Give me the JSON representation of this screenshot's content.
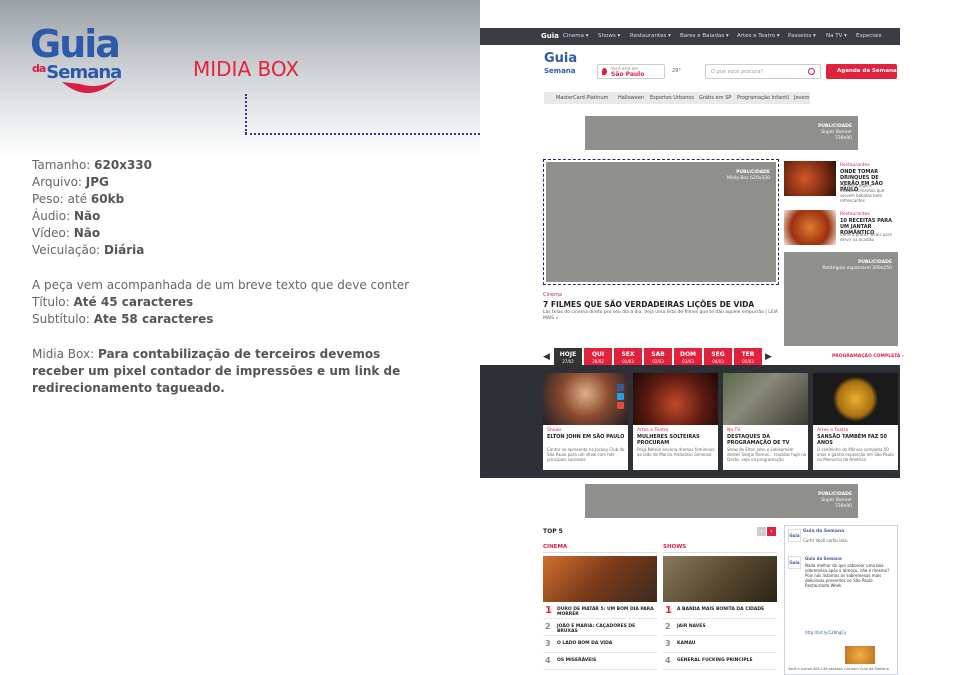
{
  "brand": {
    "name1": "Guia",
    "name2_pre": "da",
    "name2": "Semana"
  },
  "heading": "MIDIA BOX",
  "specs": [
    {
      "label": "Tamanho: ",
      "value": "620x330"
    },
    {
      "label": "Arquivo: ",
      "value": "JPG"
    },
    {
      "label": "Peso: até ",
      "value": "60kb"
    },
    {
      "label": "Áudio: ",
      "value": "Não"
    },
    {
      "label": "Vídeo: ",
      "value": "Não"
    },
    {
      "label": "Veiculação: ",
      "value": "Diária"
    }
  ],
  "desc": {
    "intro": "A peça vem acompanhada de um breve texto que deve conter",
    "titulo_label": "Título: ",
    "titulo_value": "Até 45 caracteres",
    "sub_label": "Subtítulo: ",
    "sub_value": "Ate 58 caracteres"
  },
  "midia_note": {
    "label": "Midia Box: ",
    "value": "Para contabilização de terceiros devemos receber um pixel contador de impressões e um link de redirecionamento tagueado."
  },
  "site": {
    "nav": [
      "Cinema ▾",
      "Shows ▾",
      "Restaurantes ▾",
      "Bares e Baladas ▾",
      "Artes e Teatro ▾",
      "Passeios ▾",
      "Na TV ▾",
      "Especiais"
    ],
    "city_label": "Você está em",
    "city": "São Paulo",
    "weather": "29°",
    "search_placeholder": "O que você procura?",
    "agenda": "Agenda da Semana",
    "subnav": [
      "MasterCard Platinum",
      "Halloween",
      "Esportes Urbanos",
      "Grátis em SP",
      "Programação Infantil",
      "Jovem"
    ],
    "ad1": {
      "t": "PUBLICIDADE",
      "s": "Super Banner",
      "d": "728x90"
    },
    "adbox": {
      "t": "PUBLICIDADE",
      "s": "Mídia Box 620x330"
    },
    "adrect": {
      "t": "PUBLICIDADE",
      "s": "Retângulo expansível 300x250"
    },
    "mb_cat": "Cinema",
    "mb_title": "7 FILMES QUE SÃO VERDADEIRAS LIÇÕES DE VIDA",
    "mb_sub": "Las telas do cinema direto pro seu dia a dia. Veja uma lista de filmes que te dão aquele empurrão | LEIA MAIS »",
    "side": [
      {
        "cat": "Restaurantes",
        "title": "ONDE TOMAR DRINQUES DE VERÃO EM SÃO PAULO",
        "sub": "Conheça alguns estabelecimentos que servem bebidas bem refrescantes"
      },
      {
        "cat": "Restaurantes",
        "title": "10 RECEITAS PARA UM JANTAR ROMÂNTICO",
        "sub": "Confira pratos ideais para servir na ocasião"
      }
    ],
    "days": [
      {
        "d": "HOJE",
        "n": "27/02"
      },
      {
        "d": "QUI",
        "n": "28/02"
      },
      {
        "d": "SEX",
        "n": "01/03"
      },
      {
        "d": "SAB",
        "n": "02/03"
      },
      {
        "d": "DOM",
        "n": "03/03"
      },
      {
        "d": "SEG",
        "n": "04/03"
      },
      {
        "d": "TER",
        "n": "05/03"
      }
    ],
    "prog": "PROGRAMAÇÃO COMPLETA ›",
    "cards": [
      {
        "cat": "Shows",
        "title": "ELTON JOHN EM SÃO PAULO",
        "sub": "Cantor se apresenta no Jockey Club de São Paulo para um show com hits principais sucessos"
      },
      {
        "cat": "Artes e Teatro",
        "title": "MULHERES SOLTEIRAS PROCURAM",
        "sub": "Peça Nelson encena dramas femininos ao lado de Marcio Ambrósio Gimenez"
      },
      {
        "cat": "Na TV",
        "title": "DESTAQUES DA PROGRAMAÇÃO DE TV",
        "sub": "Show do Elton John e Lobisomem destes Sergio Ramos... trazidos hoje no Oeste, veja na programação"
      },
      {
        "cat": "Artes e Teatro",
        "title": "SANSÃO TAMBÉM FAZ 50 ANOS",
        "sub": "O coelhinho da Mônica completa 50 anos e ganha exposição em São Paulo no Memorial da América"
      }
    ],
    "ad2": {
      "t": "PUBLICIDADE",
      "s": "Super Banner",
      "d": "728x90"
    },
    "top5": "TOP 5",
    "cinema_h": "CINEMA",
    "shows_h": "SHOWS",
    "cinema": [
      "DURO DE MATAR 5: UM BOM DIA PARA MORRER",
      "JOÃO E MARIA: CAÇADORES DE BRUXAS",
      "O LADO BOM DA VIDA",
      "OS MISERÁVEIS"
    ],
    "shows": [
      "A BANDA MAIS BONITA DA CIDADE",
      "JAIR NAVES",
      "KAMAU",
      "GENERAL FUCKING PRINCIPLE"
    ],
    "fb": {
      "name": "Guia da Semana",
      "like": "Curtir  Você curtiu isso.",
      "post_name": "Guia da Semana",
      "post": "Nada melhor do que saborear uma boa sobremesa após o almoço, não é mesmo? Pois nós listamos as sobremesas mais deliciosas presentes no São Paulo Restaurante Week",
      "link": "http://bit.ly/12bhgCy",
      "footer": "Você e outras 406.146 pessoas curtiram Guia da Semana"
    }
  }
}
